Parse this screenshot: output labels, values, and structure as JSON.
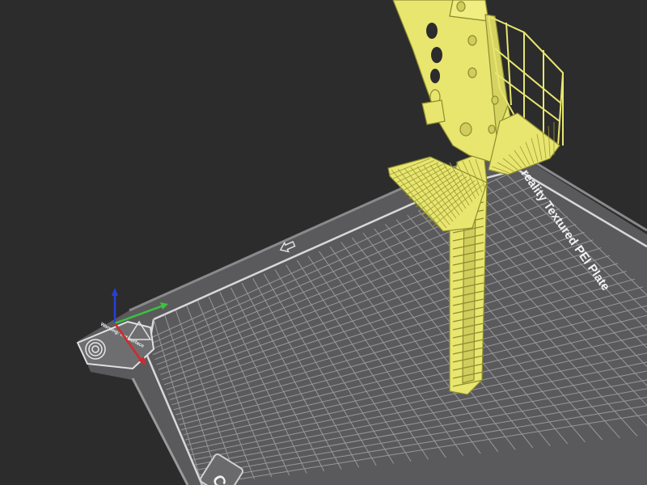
{
  "viewport": {
    "background_color": "#2c2c2d"
  },
  "build_plate": {
    "label": "reality Textured PEI Plate",
    "corner_logo_text": "CR",
    "warning_text": "Warning: hot surface",
    "plate_color": "#5a5a5c",
    "grid_color": "#9a9a9c",
    "border_color": "#bdbdbf"
  },
  "model": {
    "color": "#e8e66f",
    "outline_color": "#8e8c30"
  },
  "axes": {
    "x_color": "#d12a2a",
    "y_color": "#3cc23c",
    "z_color": "#2a3fd6"
  },
  "icons": {
    "plate_arrow": "home-arrow-icon",
    "fingerprint": "fingerprint-icon",
    "hot_surface": "hot-surface-warning-icon"
  }
}
